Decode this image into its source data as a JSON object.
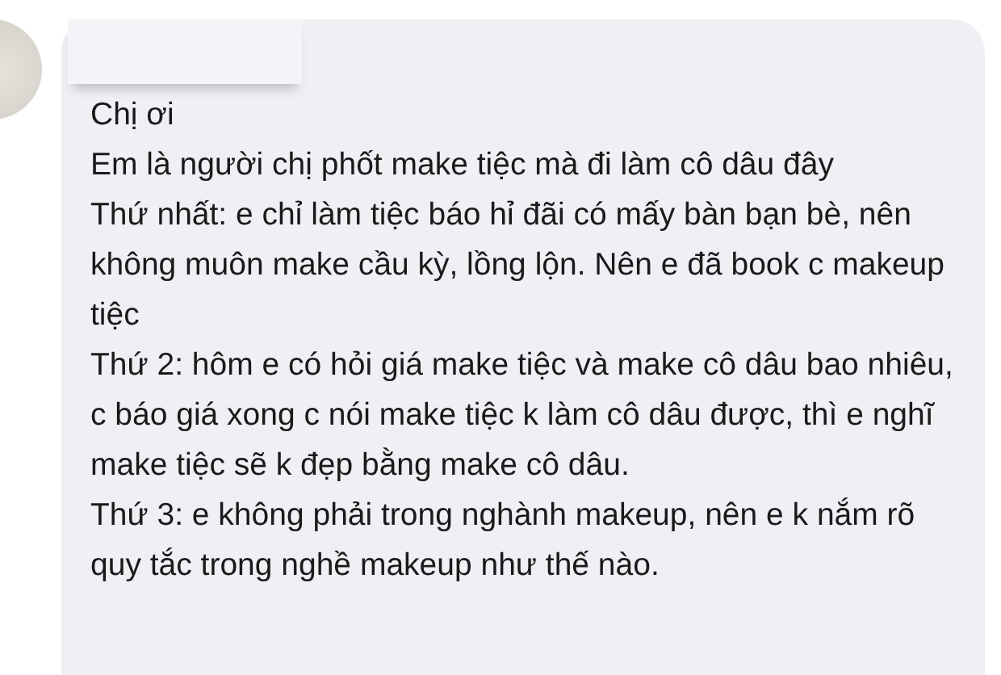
{
  "message": {
    "paragraphs": [
      "Chị ơi",
      "Em là người chị phốt make tiệc mà đi làm cô dâu đây",
      "Thứ nhất: e chỉ làm tiệc báo hỉ đãi có mấy bàn bạn bè, nên không muôn make cầu kỳ, lồng lộn. Nên e đã book c makeup tiệc",
      "Thứ 2: hôm e có hỏi giá make tiệc và make cô dâu bao nhiêu, c báo giá xong c nói make tiệc k làm cô dâu được, thì e nghĩ make tiệc sẽ k đẹp bằng make cô dâu.",
      "Thứ 3: e không phải trong nghành makeup, nên e k nắm rõ quy tắc trong nghề makeup như thế nào."
    ]
  }
}
